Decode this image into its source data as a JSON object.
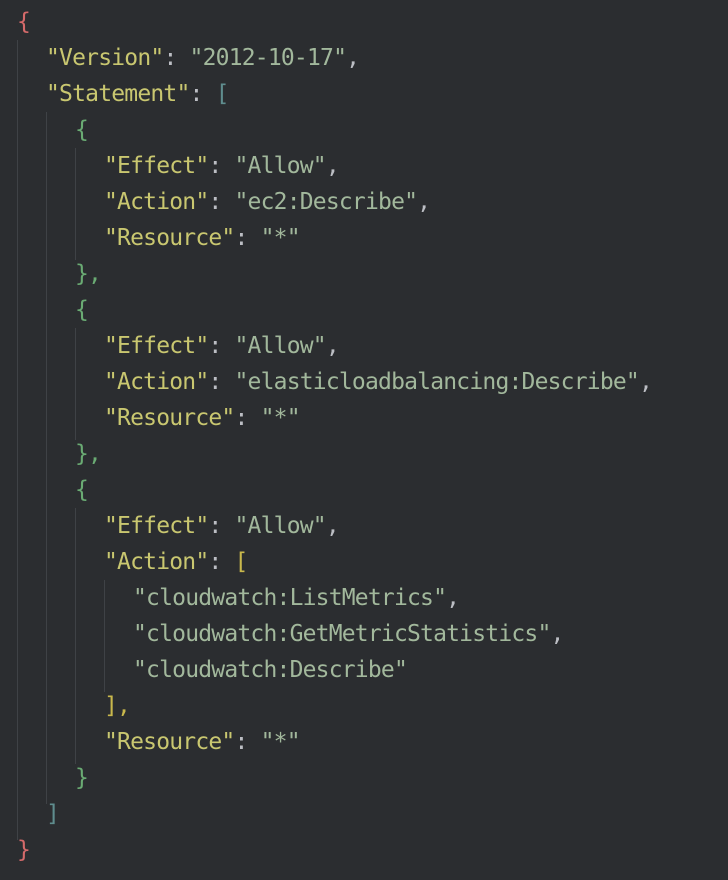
{
  "policy": {
    "open_brace": "{",
    "close_brace": "}",
    "version_key": "\"Version\"",
    "version_value": "\"2012-10-17\"",
    "statement_key": "\"Statement\"",
    "statement_open": "[",
    "statement_close": "]",
    "statements": [
      {
        "open": "{",
        "close": "},",
        "effect_key": "\"Effect\"",
        "effect_value": "\"Allow\"",
        "action_key": "\"Action\"",
        "action_value": "\"ec2:Describe\"",
        "resource_key": "\"Resource\"",
        "resource_value": "\"*\""
      },
      {
        "open": "{",
        "close": "},",
        "effect_key": "\"Effect\"",
        "effect_value": "\"Allow\"",
        "action_key": "\"Action\"",
        "action_value": "\"elasticloadbalancing:Describe\"",
        "resource_key": "\"Resource\"",
        "resource_value": "\"*\""
      },
      {
        "open": "{",
        "close": "}",
        "effect_key": "\"Effect\"",
        "effect_value": "\"Allow\"",
        "action_key": "\"Action\"",
        "action_open": "[",
        "action_close": "],",
        "action_values": [
          "\"cloudwatch:ListMetrics\"",
          "\"cloudwatch:GetMetricStatistics\"",
          "\"cloudwatch:Describe\""
        ],
        "resource_key": "\"Resource\"",
        "resource_value": "\"*\""
      }
    ]
  },
  "colors": {
    "background": "#2b2d30",
    "key": "#c9c770",
    "string": "#a2b89c",
    "punctuation": "#bcbec4",
    "brace_level_1": "#d56a6a",
    "bracket_level_2": "#5f8d8e",
    "brace_level_3": "#6aab73",
    "bracket_level_4": "#c9b84c",
    "indent_guide": "#3f4246"
  }
}
